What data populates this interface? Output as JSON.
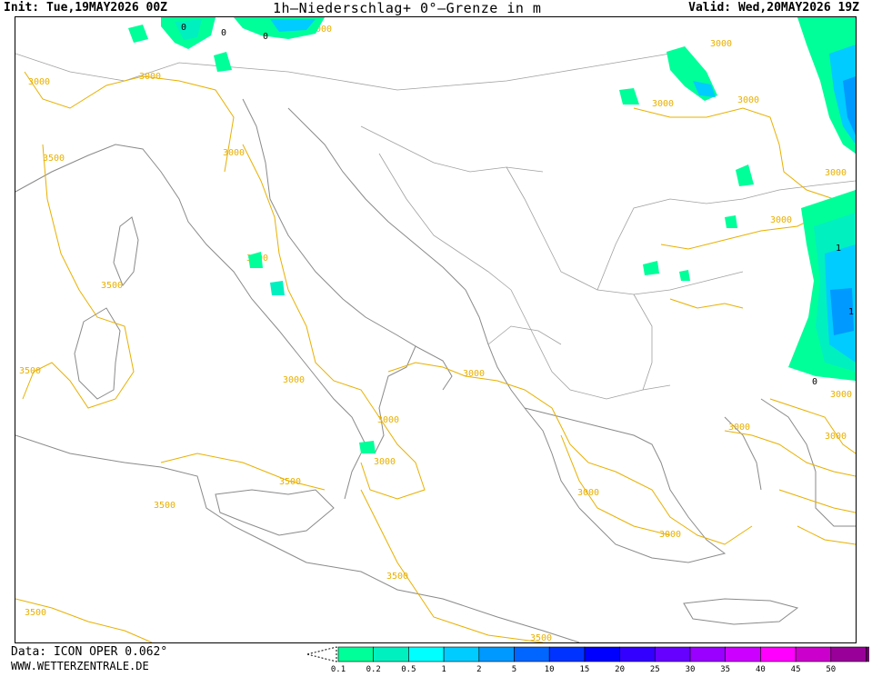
{
  "header": {
    "init": "Init: Tue,19MAY2026 00Z",
    "title": "1h–Niederschlag+ 0°–Grenze in m",
    "valid": "Valid: Wed,20MAY2026 19Z"
  },
  "footer": {
    "data_source": "Data: ICON OPER 0.062°",
    "website": "WWW.WETTERZENTRALE.DE"
  },
  "legend": {
    "colors": [
      "#00ff99",
      "#00f0c0",
      "#00ffff",
      "#00ccff",
      "#0099ff",
      "#0066ff",
      "#0033ff",
      "#0000ff",
      "#3300ff",
      "#6600ff",
      "#9900ff",
      "#cc00ff",
      "#ff00ff",
      "#cc00cc",
      "#990099",
      "#660066"
    ],
    "labels": [
      "0.1",
      "0.2",
      "0.5",
      "1",
      "2",
      "5",
      "10",
      "15",
      "20",
      "25",
      "30",
      "35",
      "40",
      "45",
      "50"
    ]
  },
  "contour_labels": [
    "3000",
    "3500",
    "0",
    "1"
  ],
  "colors": {
    "contour": "#e8b000",
    "coast": "#8a8a8a",
    "border": "#8a8a8a"
  }
}
